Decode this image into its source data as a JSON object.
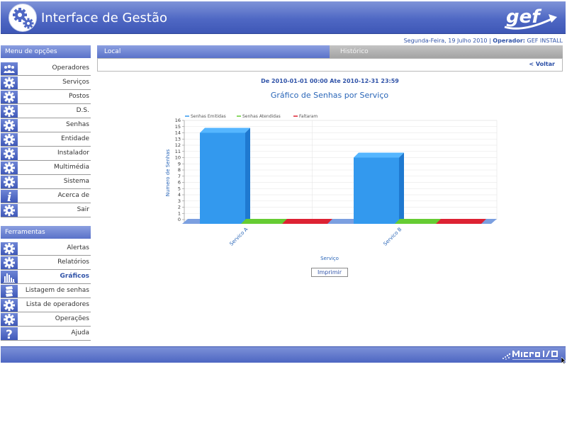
{
  "header": {
    "title": "Interface de Gestão",
    "logo_text": "gef"
  },
  "status": {
    "date": "Segunda-Feira, 19 Julho 2010",
    "operator_label": "Operador:",
    "operator": "GEF INSTALL"
  },
  "sidebar": {
    "menu_title": "Menu de opções",
    "menu_items": [
      {
        "label": "Operadores",
        "icon": "users-icon"
      },
      {
        "label": "Serviços",
        "icon": "gear-icon"
      },
      {
        "label": "Postos",
        "icon": "gear-icon"
      },
      {
        "label": "D.S.",
        "icon": "gear-icon"
      },
      {
        "label": "Senhas",
        "icon": "gear-icon"
      },
      {
        "label": "Entidade",
        "icon": "gear-icon"
      },
      {
        "label": "Instalador",
        "icon": "gear-icon"
      },
      {
        "label": "Multimédia",
        "icon": "gear-icon"
      },
      {
        "label": "Sistema",
        "icon": "gear-icon"
      },
      {
        "label": "Acerca de",
        "icon": "info-icon"
      },
      {
        "label": "Sair",
        "icon": "gear-icon"
      }
    ],
    "tools_title": "Ferramentas",
    "tools_items": [
      {
        "label": "Alertas",
        "icon": "gear-icon",
        "active": false
      },
      {
        "label": "Relatórios",
        "icon": "gear-icon",
        "active": false
      },
      {
        "label": "Gráficos",
        "icon": "bar-chart-icon",
        "active": true
      },
      {
        "label": "Listagem de senhas",
        "icon": "tickets-icon",
        "active": false
      },
      {
        "label": "Lista de operadores",
        "icon": "gear-icon",
        "active": false
      },
      {
        "label": "Operações",
        "icon": "gear-icon",
        "active": false
      },
      {
        "label": "Ajuda",
        "icon": "help-icon",
        "active": false
      }
    ]
  },
  "tabs": {
    "local": "Local",
    "historico": "Histórico"
  },
  "toolbar": {
    "back_label": "< Voltar"
  },
  "report": {
    "date_range": "De 2010-01-01 00:00 Ate 2010-12-31 23:59",
    "print_label": "Imprimir"
  },
  "chart_data": {
    "type": "bar",
    "title": "Gráfico de Senhas por Serviço",
    "xlabel": "Serviço",
    "ylabel": "Numero de Senhas",
    "categories": [
      "Servico A",
      "Servico B"
    ],
    "series": [
      {
        "name": "Senhas Emitidas",
        "values": [
          14,
          10
        ],
        "color": "#3399ee"
      },
      {
        "name": "Senhas Atendidas",
        "values": [
          0,
          0
        ],
        "color": "#66cc33"
      },
      {
        "name": "Faltaram",
        "values": [
          0,
          0
        ],
        "color": "#dd2233"
      }
    ],
    "ylim": [
      0,
      16
    ],
    "yticks": [
      0,
      1,
      2,
      3,
      4,
      5,
      6,
      7,
      8,
      9,
      10,
      11,
      12,
      13,
      14,
      15,
      16
    ],
    "grid": true,
    "legend_position": "top-left"
  },
  "colors": {
    "header_blue": "#4f68c4",
    "link_blue": "#3053a8",
    "tab_gray": "#a3a3a3"
  }
}
